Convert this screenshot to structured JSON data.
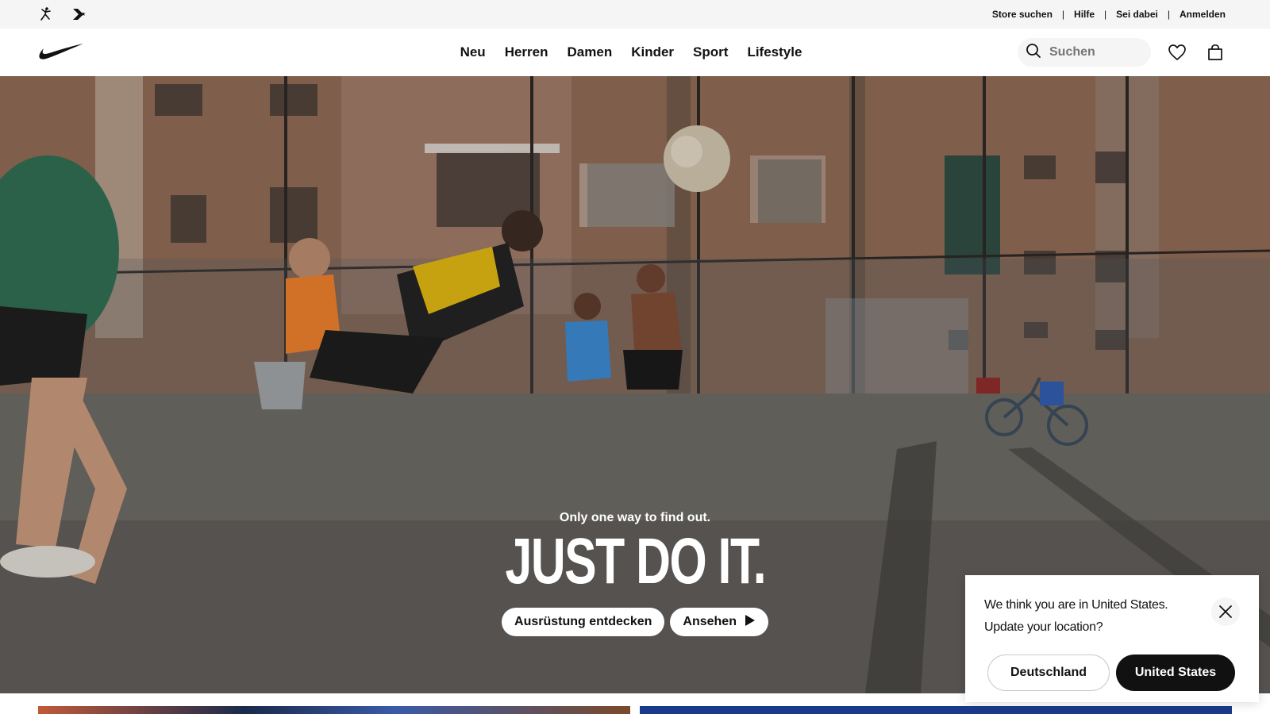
{
  "utility_bar": {
    "brand_icons": [
      "jordan-jumpman-icon",
      "converse-icon"
    ],
    "links": [
      "Store suchen",
      "Hilfe",
      "Sei dabei",
      "Anmelden"
    ]
  },
  "nav": {
    "logo": "nike-swoosh-icon",
    "items": [
      "Neu",
      "Herren",
      "Damen",
      "Kinder",
      "Sport",
      "Lifestyle"
    ],
    "search_placeholder": "Suchen",
    "icons": [
      "search-icon",
      "heart-icon",
      "bag-icon"
    ]
  },
  "hero": {
    "subtitle": "Only one way to find out.",
    "title": "JUST DO IT.",
    "cta_primary": "Ausrüstung entdecken",
    "cta_secondary": "Ansehen"
  },
  "location_popup": {
    "line1": "We think you are in United States.",
    "line2": "Update your location?",
    "button_secondary": "Deutschland",
    "button_primary": "United States"
  },
  "colors": {
    "brand_black": "#111111",
    "utility_bg": "#f5f5f5",
    "white": "#ffffff"
  }
}
